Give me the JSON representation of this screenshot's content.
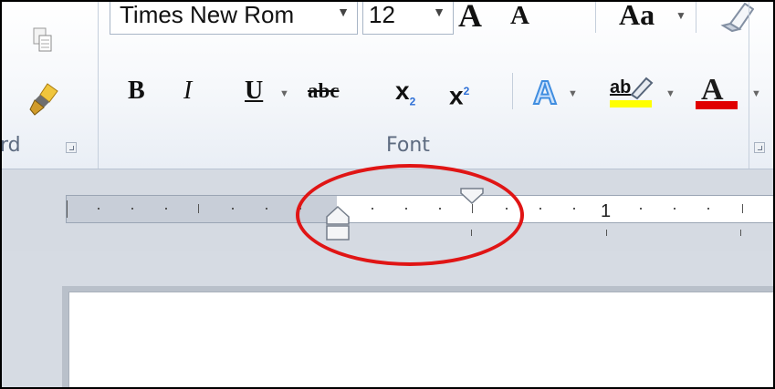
{
  "clipboard_group": {
    "label": "rd",
    "copy_icon": "copy-icon",
    "format_painter_icon": "format-painter-icon"
  },
  "font_group": {
    "label": "Font",
    "font_name": "Times New Rom",
    "font_size": "12",
    "grow_font_label": "A",
    "shrink_font_label": "A",
    "change_case_label": "Aa",
    "buttons": {
      "bold": "B",
      "italic": "I",
      "underline": "U",
      "strikethrough": "abc",
      "subscript": "x",
      "subscript_mark": "2",
      "superscript": "x",
      "superscript_mark": "2",
      "highlight": "ab",
      "font_color": "A"
    },
    "colors": {
      "highlight": "#ffff00",
      "font_color": "#e00000",
      "text_effects": "#3f8de0"
    }
  },
  "ruler": {
    "label_one": "1"
  },
  "annotation": {
    "color": "#e01515"
  }
}
